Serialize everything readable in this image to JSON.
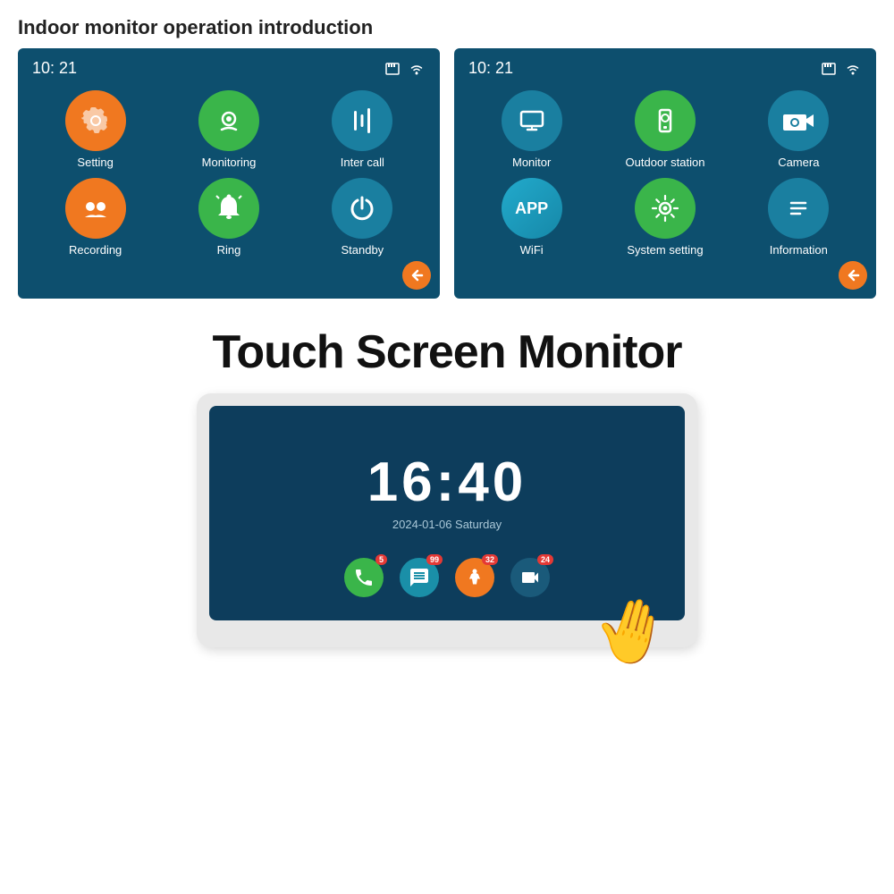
{
  "page_title": "Indoor monitor operation introduction",
  "screen1": {
    "time": "10: 21",
    "apps": [
      {
        "label": "Setting",
        "color": "orange",
        "icon": "gear"
      },
      {
        "label": "Monitoring",
        "color": "green",
        "icon": "camera-circle"
      },
      {
        "label": "Inter call",
        "color": "teal",
        "icon": "equalizer"
      },
      {
        "label": "Recording",
        "color": "orange",
        "icon": "people"
      },
      {
        "label": "Ring",
        "color": "green",
        "icon": "bell"
      },
      {
        "label": "Standby",
        "color": "teal",
        "icon": "power"
      }
    ]
  },
  "screen2": {
    "time": "10: 21",
    "apps": [
      {
        "label": "Monitor",
        "color": "teal",
        "icon": "monitor"
      },
      {
        "label": "Outdoor station",
        "color": "green",
        "icon": "outdoor"
      },
      {
        "label": "Camera",
        "color": "teal",
        "icon": "cctv"
      },
      {
        "label": "WiFi",
        "color": "cyan",
        "icon": "app-text"
      },
      {
        "label": "System setting",
        "color": "green",
        "icon": "gear"
      },
      {
        "label": "Information",
        "color": "teal",
        "icon": "list"
      }
    ]
  },
  "touch_title": "Touch Screen Monitor",
  "monitor_time": "16:40",
  "monitor_date": "2024-01-06  Saturday",
  "bottom_icons": [
    {
      "color": "green",
      "badge": "5",
      "icon": "phone"
    },
    {
      "color": "teal",
      "badge": "99",
      "icon": "chat"
    },
    {
      "color": "orange",
      "badge": "32",
      "icon": "person-motion"
    },
    {
      "color": "teal-dark",
      "badge": "24",
      "icon": "camera-badge"
    }
  ]
}
